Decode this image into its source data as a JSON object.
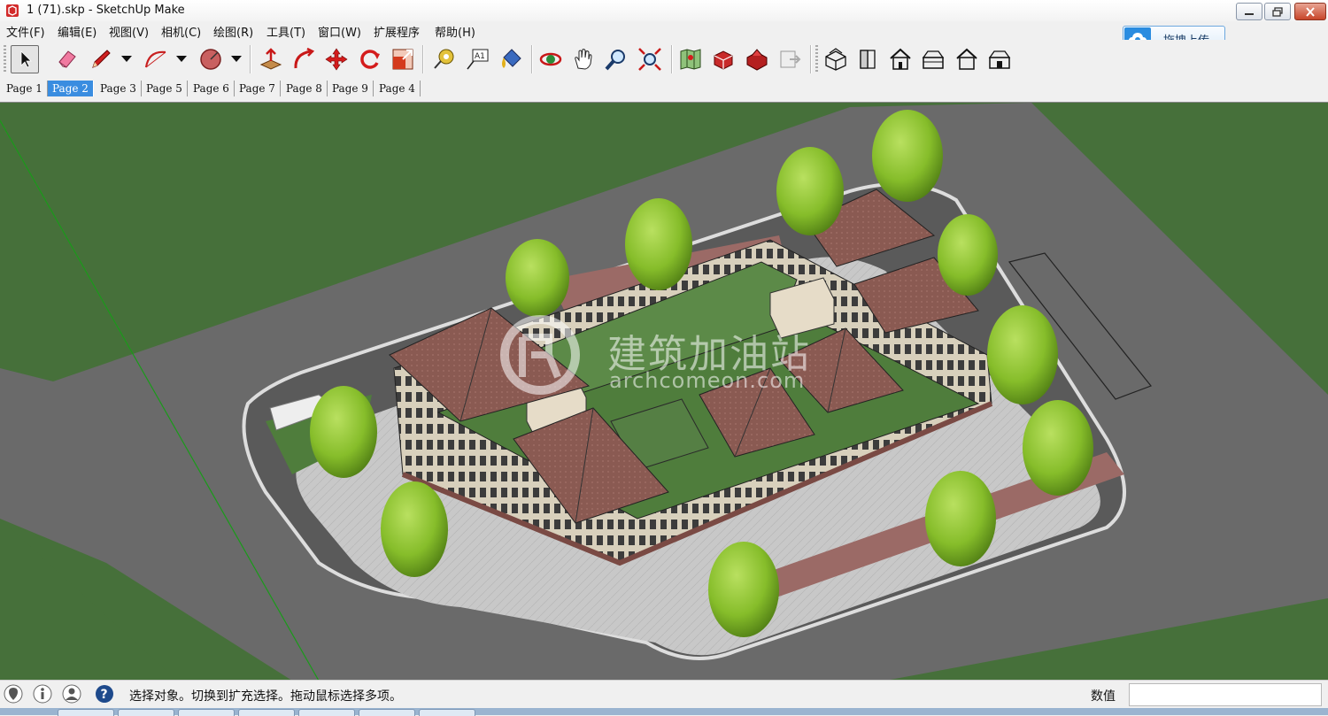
{
  "window": {
    "title": "1 (71).skp - SketchUp Make"
  },
  "menu": {
    "items": [
      "文件(F)",
      "编辑(E)",
      "视图(V)",
      "相机(C)",
      "绘图(R)",
      "工具(T)",
      "窗口(W)",
      "扩展程序",
      "帮助(H)"
    ]
  },
  "upload": {
    "label": "拖拽上传"
  },
  "tabs": {
    "items": [
      "Page 1",
      "Page 2",
      "Page 3",
      "Page 5",
      "Page 6",
      "Page 7",
      "Page 8",
      "Page 9",
      "Page 4"
    ],
    "active": "Page 2"
  },
  "toolbar": {
    "tools": [
      "select-icon",
      "eraser-icon",
      "pencil-icon",
      "arc-icon",
      "shape-icon",
      "push-pull-icon",
      "follow-me-icon",
      "move-icon",
      "rotate-icon",
      "scale-icon",
      "tape-measure-icon",
      "text-icon",
      "paint-bucket-icon",
      "orbit-icon",
      "pan-icon",
      "zoom-icon",
      "zoom-extents-icon",
      "map-icon",
      "warehouse-icon",
      "extension-warehouse-icon",
      "layout-icon",
      "iso-view-icon",
      "top-view-icon",
      "front-view-icon",
      "right-view-icon",
      "back-view-icon",
      "left-view-icon"
    ]
  },
  "watermark": {
    "cn": "建筑加油站",
    "en": "archcomeon.com"
  },
  "status": {
    "message": "选择对象。切换到扩充选择。拖动鼠标选择多项。",
    "measurements_label": "数值",
    "measurements_value": ""
  },
  "colors": {
    "grass": "#46703a",
    "road": "#6a6a6a",
    "paving": "#c9c9c9",
    "roof": "#8a5a50",
    "roof_garden": "#4f7d3c",
    "tree": "#8cc22e",
    "accent_tab": "#3a8de0"
  }
}
